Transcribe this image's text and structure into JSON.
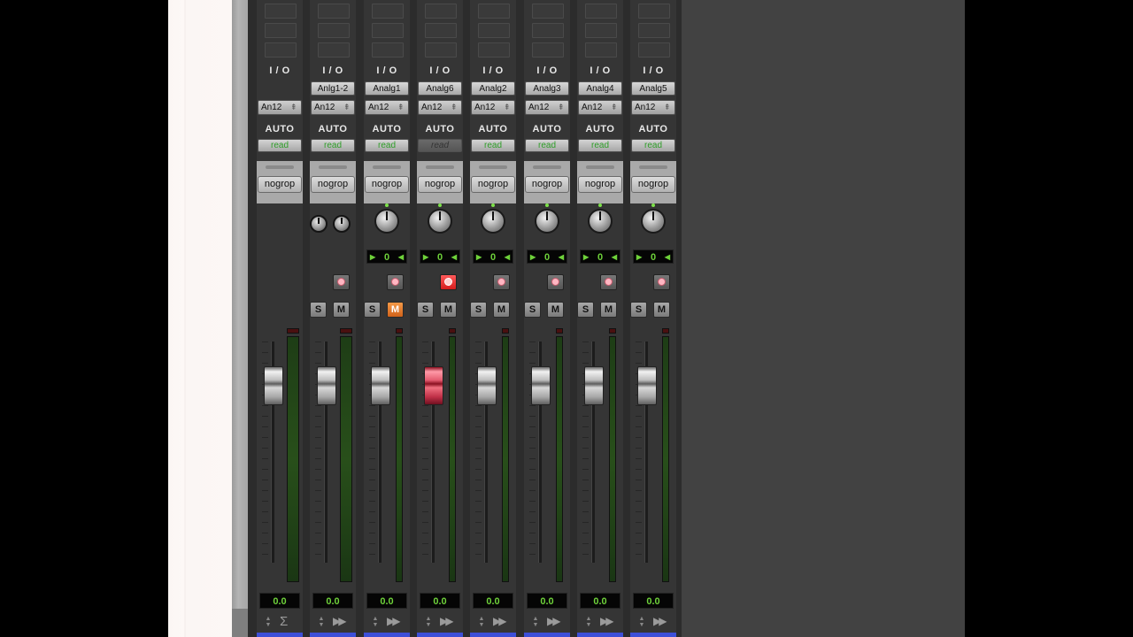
{
  "strips": [
    {
      "io_label": "I / O",
      "input": "",
      "output": "An12",
      "auto_label": "AUTO",
      "auto_mode": "read",
      "auto_active": true,
      "group": "nogrop",
      "knob": "none",
      "pan": "",
      "rec_armed": false,
      "has_rec": false,
      "has_sm": false,
      "mute_on": false,
      "selected": false,
      "volume": "0.0",
      "fader_level": 0.8,
      "footer_icon": "sum-icon",
      "footer_glyph": "Σ"
    },
    {
      "io_label": "I / O",
      "input": "Anlg1-2",
      "output": "An12",
      "auto_label": "AUTO",
      "auto_mode": "read",
      "auto_active": true,
      "group": "nogrop",
      "knob": "stereo",
      "pan": "",
      "rec_armed": false,
      "has_rec": true,
      "has_sm": true,
      "mute_on": false,
      "selected": false,
      "volume": "0.0",
      "fader_level": 0.8,
      "footer_icon": "ff-icon",
      "footer_glyph": "▶▶"
    },
    {
      "io_label": "I / O",
      "input": "Analg1",
      "output": "An12",
      "auto_label": "AUTO",
      "auto_mode": "read",
      "auto_active": true,
      "group": "nogrop",
      "knob": "mono",
      "pan": "0",
      "rec_armed": false,
      "has_rec": true,
      "has_sm": true,
      "mute_on": true,
      "selected": false,
      "volume": "0.0",
      "fader_level": 0.8,
      "footer_icon": "ff-icon",
      "footer_glyph": "▶▶"
    },
    {
      "io_label": "I / O",
      "input": "Analg6",
      "output": "An12",
      "auto_label": "AUTO",
      "auto_mode": "read",
      "auto_active": false,
      "group": "nogrop",
      "knob": "mono",
      "pan": "0",
      "rec_armed": true,
      "has_rec": true,
      "has_sm": true,
      "mute_on": false,
      "selected": true,
      "volume": "0.0",
      "fader_level": 0.8,
      "footer_icon": "ff-icon",
      "footer_glyph": "▶▶"
    },
    {
      "io_label": "I / O",
      "input": "Analg2",
      "output": "An12",
      "auto_label": "AUTO",
      "auto_mode": "read",
      "auto_active": true,
      "group": "nogrop",
      "knob": "mono",
      "pan": "0",
      "rec_armed": false,
      "has_rec": true,
      "has_sm": true,
      "mute_on": false,
      "selected": false,
      "volume": "0.0",
      "fader_level": 0.8,
      "footer_icon": "ff-icon",
      "footer_glyph": "▶▶"
    },
    {
      "io_label": "I / O",
      "input": "Analg3",
      "output": "An12",
      "auto_label": "AUTO",
      "auto_mode": "read",
      "auto_active": true,
      "group": "nogrop",
      "knob": "mono",
      "pan": "0",
      "rec_armed": false,
      "has_rec": true,
      "has_sm": true,
      "mute_on": false,
      "selected": false,
      "volume": "0.0",
      "fader_level": 0.8,
      "footer_icon": "ff-icon",
      "footer_glyph": "▶▶"
    },
    {
      "io_label": "I / O",
      "input": "Analg4",
      "output": "An12",
      "auto_label": "AUTO",
      "auto_mode": "read",
      "auto_active": true,
      "group": "nogrop",
      "knob": "mono",
      "pan": "0",
      "rec_armed": false,
      "has_rec": true,
      "has_sm": true,
      "mute_on": false,
      "selected": false,
      "volume": "0.0",
      "fader_level": 0.8,
      "footer_icon": "ff-icon",
      "footer_glyph": "▶▶"
    },
    {
      "io_label": "I / O",
      "input": "Analg5",
      "output": "An12",
      "auto_label": "AUTO",
      "auto_mode": "read",
      "auto_active": true,
      "group": "nogrop",
      "knob": "mono",
      "pan": "0",
      "rec_armed": false,
      "has_rec": true,
      "has_sm": true,
      "mute_on": false,
      "selected": false,
      "volume": "0.0",
      "fader_level": 0.8,
      "footer_icon": "ff-icon",
      "footer_glyph": "▶▶"
    }
  ],
  "button_labels": {
    "solo": "S",
    "mute": "M"
  },
  "colors": {
    "meter_green": "#6ed13a",
    "record_red": "#e02020",
    "mute_orange": "#e57a2a",
    "selected_fader": "#d03048",
    "track_name_bar": "#3d4fd8"
  }
}
